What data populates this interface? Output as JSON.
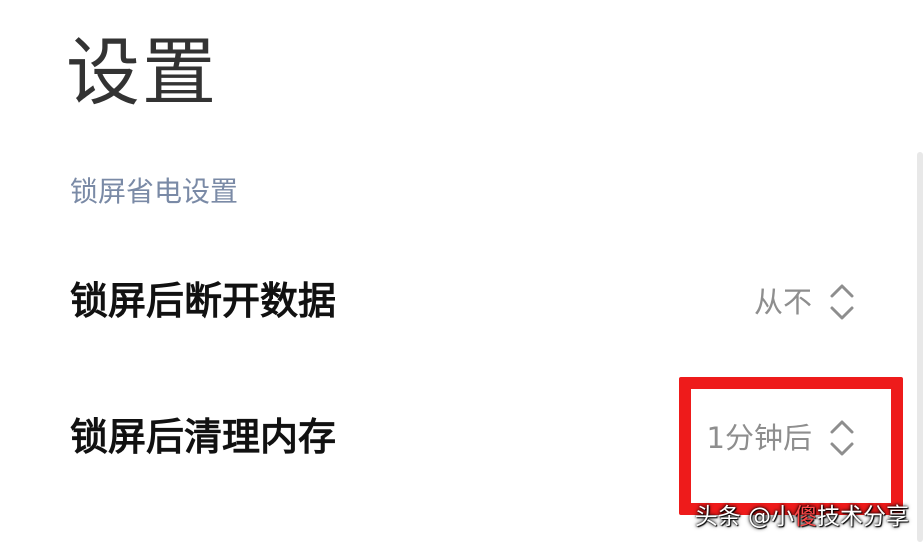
{
  "header": {
    "title": "设置"
  },
  "section": {
    "title": "锁屏省电设置"
  },
  "settings": [
    {
      "label": "锁屏后断开数据",
      "value": "从不",
      "icon": "chevron-up-down-icon"
    },
    {
      "label": "锁屏后清理内存",
      "value": "1分钟后",
      "icon": "chevron-up-down-icon"
    }
  ],
  "annotation": {
    "color": "#ee1b1b"
  },
  "watermark": {
    "prefix": "头条 @小",
    "accent": "傻",
    "suffix": "技术分享"
  },
  "colors": {
    "title": "#333333",
    "section": "#7a8aa6",
    "label": "#111111",
    "value": "#8e8e8e"
  }
}
